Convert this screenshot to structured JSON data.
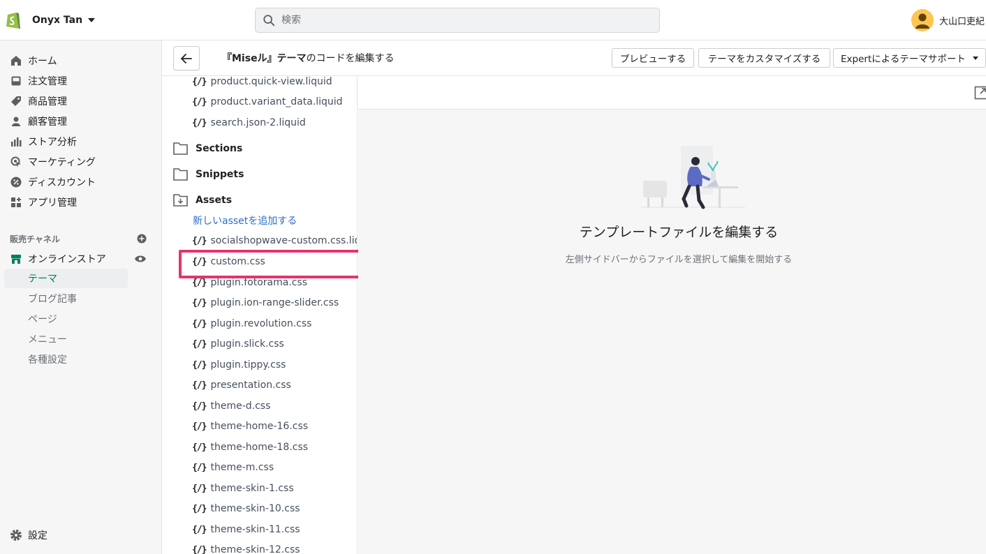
{
  "topbar": {
    "store_name": "Onyx Tan",
    "search_placeholder": "検索",
    "user_name": "大山口吏紀"
  },
  "sidebar": {
    "items": [
      {
        "label": "ホーム",
        "icon": "home-icon"
      },
      {
        "label": "注文管理",
        "icon": "inbox-icon"
      },
      {
        "label": "商品管理",
        "icon": "tag-icon"
      },
      {
        "label": "顧客管理",
        "icon": "person-icon"
      },
      {
        "label": "ストア分析",
        "icon": "bar-chart-icon"
      },
      {
        "label": "マーケティング",
        "icon": "target-icon"
      },
      {
        "label": "ディスカウント",
        "icon": "discount-icon"
      },
      {
        "label": "アプリ管理",
        "icon": "apps-icon"
      }
    ],
    "sales_channels_label": "販売チャネル",
    "online_store_label": "オンラインストア",
    "sub_items": [
      "テーマ",
      "ブログ記事",
      "ページ",
      "メニュー",
      "各種設定"
    ],
    "settings_label": "設定"
  },
  "editor": {
    "title_name": "『Miseル』テーマ",
    "title_suffix": "のコードを編集する",
    "preview_label": "プレビューする",
    "customize_label": "テーマをカスタマイズする",
    "expert_label": "Expertによるテーマサポート"
  },
  "files": {
    "bracket": "{/}",
    "top_files": [
      "product.quick-view.liquid",
      "product.variant_data.liquid",
      "search.json-2.liquid"
    ],
    "folders": [
      "Sections",
      "Snippets",
      "Assets"
    ],
    "add_asset_label": "新しいassetを追加する",
    "asset_files": [
      "socialshopwave-custom.css.liquid",
      "custom.css",
      "plugin.fotorama.css",
      "plugin.ion-range-slider.css",
      "plugin.revolution.css",
      "plugin.slick.css",
      "plugin.tippy.css",
      "presentation.css",
      "theme-d.css",
      "theme-home-16.css",
      "theme-home-18.css",
      "theme-m.css",
      "theme-skin-1.css",
      "theme-skin-10.css",
      "theme-skin-11.css",
      "theme-skin-12.css"
    ]
  },
  "empty_state": {
    "title": "テンプレートファイルを編集する",
    "subtitle": "左側サイドバーからファイルを選択して編集を開始する"
  },
  "colors": {
    "accent_green": "#007f5f",
    "link_blue": "#2c6ecb",
    "highlight_pink": "#e6336d",
    "shopify_green": "#95bf47"
  }
}
